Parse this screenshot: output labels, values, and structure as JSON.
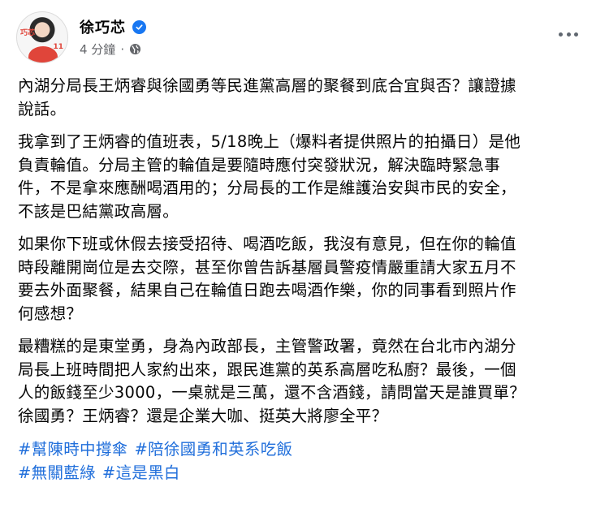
{
  "post": {
    "author": "徐巧芯",
    "timestamp": "4 分鐘",
    "separator": "·",
    "privacy_icon": "globe-icon",
    "avatar": {
      "badge_text": "11",
      "mark_text": "巧芯"
    },
    "paragraphs": [
      "內湖分局長王炳睿與徐國勇等民進黨高層的聚餐到底合宜與否？讓證據\n說話。",
      "我拿到了王炳睿的值班表，5/18晚上（爆料者提供照片的拍攝日）是他\n負責輪值。分局主管的輪值是要隨時應付突發狀況，解決臨時緊急事\n件，不是拿來應酬喝酒用的；分局長的工作是維護治安與市民的安全，\n不該是巴結黨政高層。",
      "如果你下班或休假去接受招待、喝酒吃飯，我沒有意見，但在你的輪值\n時段離開崗位是去交際，甚至你曾告訴基層員警疫情嚴重請大家五月不\n要去外面聚餐，結果自己在輪值日跑去喝酒作樂，你的同事看到照片作\n何感想？",
      "最糟糕的是東堂勇，身為內政部長，主管警政署，竟然在台北市內湖分\n局長上班時間把人家約出來，跟民進黨的英系高層吃私廚？最後，一個\n人的飯錢至少3000，一桌就是三萬，還不含酒錢，請問當天是誰買單？\n徐國勇？王炳睿？還是企業大咖、挺英大將廖全平？"
    ],
    "hashtags": [
      [
        "#幫陳時中撐傘",
        "#陪徐國勇和英系吃飯"
      ],
      [
        "#無關藍綠",
        "#這是黑白"
      ]
    ]
  },
  "colors": {
    "link": "#216fdb",
    "verified": "#1877f2",
    "meta": "#65676b"
  }
}
